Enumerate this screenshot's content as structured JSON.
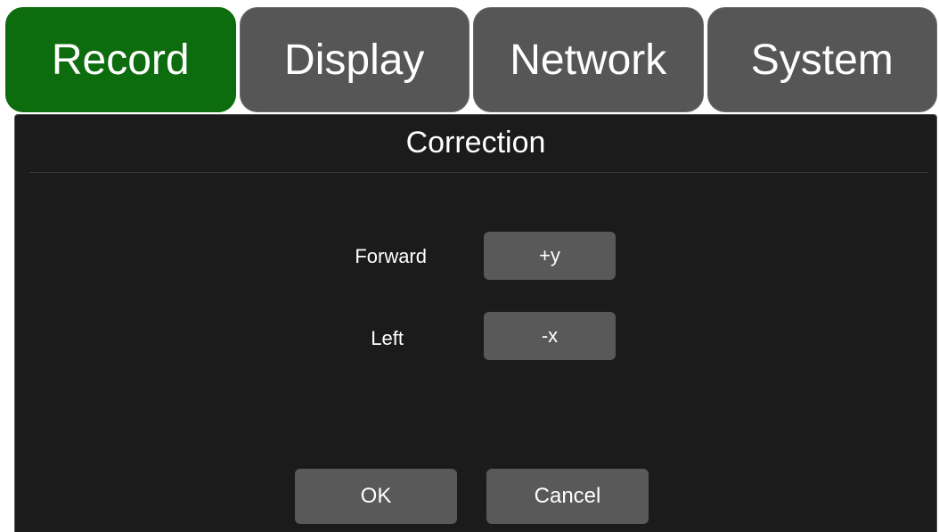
{
  "tabs": [
    {
      "label": "Record",
      "active": true
    },
    {
      "label": "Display",
      "active": false
    },
    {
      "label": "Network",
      "active": false
    },
    {
      "label": "System",
      "active": false
    }
  ],
  "dialog": {
    "title": "Correction",
    "rows": [
      {
        "label": "Forward",
        "value": "+y"
      },
      {
        "label": "Left",
        "value": "-x"
      }
    ],
    "ok_label": "OK",
    "cancel_label": "Cancel"
  },
  "colors": {
    "active_tab": "#0d6c0d",
    "inactive_tab": "#565656",
    "panel_bg": "#1b1b1b",
    "button_bg": "#595959"
  }
}
